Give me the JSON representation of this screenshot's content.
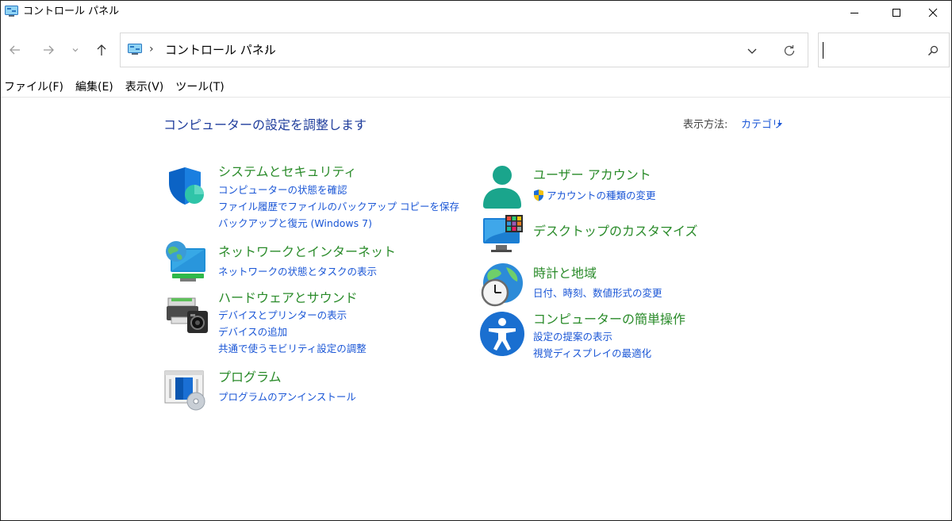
{
  "window": {
    "title": "コントロール パネル",
    "controls": {
      "minimize": "minimize-icon",
      "maximize": "maximize-icon",
      "close": "close-icon"
    }
  },
  "nav": {
    "back_icon": "arrow-left-icon",
    "forward_icon": "arrow-right-icon",
    "recent_icon": "chevron-down-icon",
    "up_icon": "arrow-up-icon",
    "breadcrumb": "コントロール パネル",
    "search_placeholder": ""
  },
  "menu": {
    "items": [
      {
        "label": "ファイル(F)"
      },
      {
        "label": "編集(E)"
      },
      {
        "label": "表示(V)"
      },
      {
        "label": "ツール(T)"
      }
    ]
  },
  "main": {
    "title": "コンピューターの設定を調整します",
    "view_by_label": "表示方法:",
    "view_by_value": "カテゴリ",
    "categories": [
      {
        "icon": "shield-icon",
        "title": "システムとセキュリティ",
        "links": [
          "コンピューターの状態を確認",
          "ファイル履歴でファイルのバックアップ コピーを保存",
          "バックアップと復元 (Windows 7)"
        ]
      },
      {
        "icon": "network-globe-icon",
        "title": "ネットワークとインターネット",
        "links": [
          "ネットワークの状態とタスクの表示"
        ]
      },
      {
        "icon": "printer-camera-icon",
        "title": "ハードウェアとサウンド",
        "links": [
          "デバイスとプリンターの表示",
          "デバイスの追加",
          "共通で使うモビリティ設定の調整"
        ]
      },
      {
        "icon": "programs-icon",
        "title": "プログラム",
        "links": [
          "プログラムのアンインストール"
        ]
      },
      {
        "icon": "user-icon",
        "title": "ユーザー アカウント",
        "links": [
          "アカウントの種類の変更"
        ],
        "link_icon": "uac-shield-icon"
      },
      {
        "icon": "desktop-icon",
        "title": "デスクトップのカスタマイズ",
        "links": []
      },
      {
        "icon": "clock-globe-icon",
        "title": "時計と地域",
        "links": [
          "日付、時刻、数値形式の変更"
        ]
      },
      {
        "icon": "accessibility-icon",
        "title": "コンピューターの簡単操作",
        "links": [
          "設定の提案の表示",
          "視覚ディスプレイの最適化"
        ]
      }
    ]
  },
  "colors": {
    "link": "#1a56d6",
    "category_title": "#2a8b2a",
    "page_title": "#1f3d9c",
    "accent_blue": "#0a66c2",
    "teal": "#1fb39a"
  }
}
